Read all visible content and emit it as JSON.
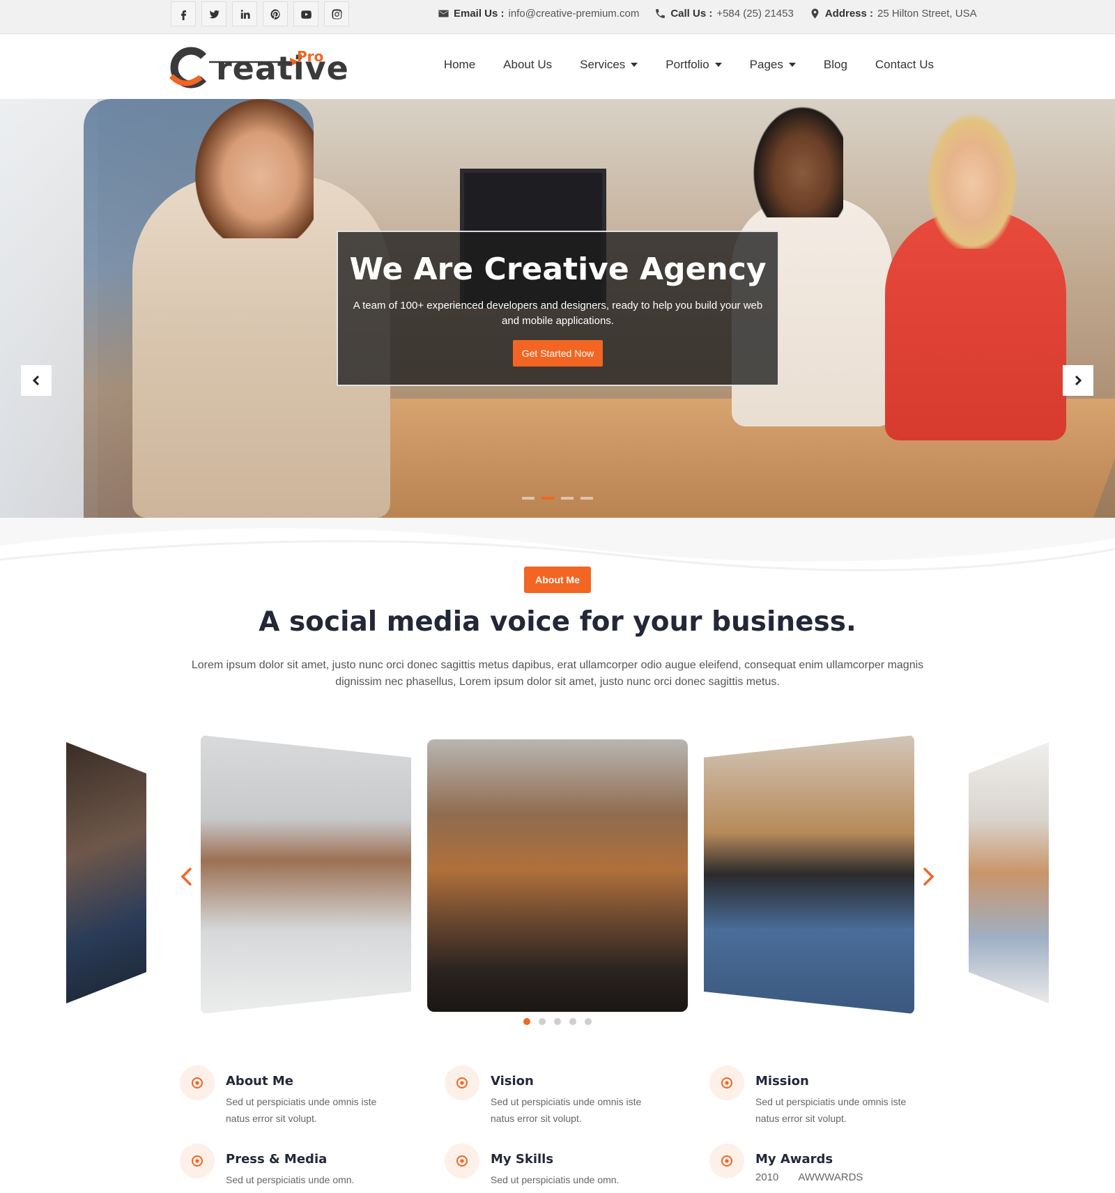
{
  "topbar": {
    "social": [
      "facebook-icon",
      "twitter-icon",
      "linkedin-icon",
      "pinterest-icon",
      "youtube-icon",
      "instagram-icon"
    ],
    "email_label": "Email Us :",
    "email_value": "info@creative-premium.com",
    "call_label": "Call Us :",
    "call_value": "+584 (25) 21453",
    "address_label": "Address :",
    "address_value": "25 Hilton Street, USA"
  },
  "header": {
    "logo_word": "reative",
    "logo_pro": "Pro",
    "nav": [
      {
        "label": "Home",
        "dropdown": false
      },
      {
        "label": "About Us",
        "dropdown": false
      },
      {
        "label": "Services",
        "dropdown": true
      },
      {
        "label": "Portfolio",
        "dropdown": true
      },
      {
        "label": "Pages",
        "dropdown": true
      },
      {
        "label": "Blog",
        "dropdown": false
      },
      {
        "label": "Contact Us",
        "dropdown": false
      }
    ]
  },
  "hero": {
    "title": "We Are Creative Agency",
    "subtitle": "A team of 100+ experienced developers and designers, ready to help you build your web and mobile applications.",
    "cta": "Get Started Now",
    "active_slide_index": 1,
    "slide_count": 4
  },
  "about": {
    "badge": "About Me",
    "title": "A social media voice for your business.",
    "text": "Lorem ipsum dolor sit amet, justo nunc orci donec sagittis metus dapibus, erat ullamcorper odio augue eleifend, consequat enim ullamcorper magnis dignissim nec phasellus, Lorem ipsum dolor sit amet, justo nunc orci donec sagittis metus."
  },
  "gallery": {
    "active_index": 0,
    "dot_count": 5
  },
  "features": [
    {
      "title": "About Me",
      "text": "Sed ut perspiciatis unde omnis iste natus error sit volupt."
    },
    {
      "title": "Vision",
      "text": "Sed ut perspiciatis unde omnis iste natus error sit volupt."
    },
    {
      "title": "Mission",
      "text": "Sed ut perspiciatis unde omnis iste natus error sit volupt."
    },
    {
      "title": "Press & Media",
      "text": "Sed ut perspiciatis unde omn."
    },
    {
      "title": "My Skills",
      "text": "Sed ut perspiciatis unde omn."
    },
    {
      "title": "My Awards",
      "text": "",
      "award_year": "2010",
      "award_name": "AWWWARDS"
    }
  ],
  "colors": {
    "accent": "#f26522",
    "dark_text": "#222838",
    "topbar_bg": "#f1f1f1"
  }
}
